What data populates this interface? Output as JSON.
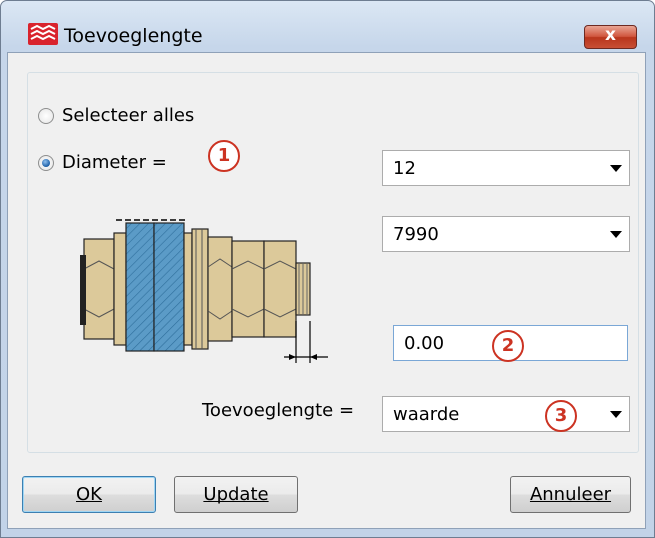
{
  "window": {
    "title": "Toevoeglengte",
    "close_glyph": "x"
  },
  "options": {
    "select_all_label": "Selecteer alles",
    "diameter_label": "Diameter =",
    "selected": "diameter"
  },
  "callouts": [
    "1",
    "2",
    "3"
  ],
  "fields": {
    "diameter_value": "12",
    "standard_value": "7990",
    "length_value": "0.00",
    "toevoeglengte_label": "Toevoeglengte =",
    "toevoeglengte_value": "waarde"
  },
  "buttons": {
    "ok_label": "OK",
    "update_label": "Update",
    "cancel_label": "Annuleer"
  },
  "icons": {
    "app": "tekla-app-icon",
    "dropdown": "chevron-down-icon"
  },
  "colors": {
    "accent": "#cc3322",
    "plate": "#5b9bc7",
    "nut": "#dcc99a"
  }
}
